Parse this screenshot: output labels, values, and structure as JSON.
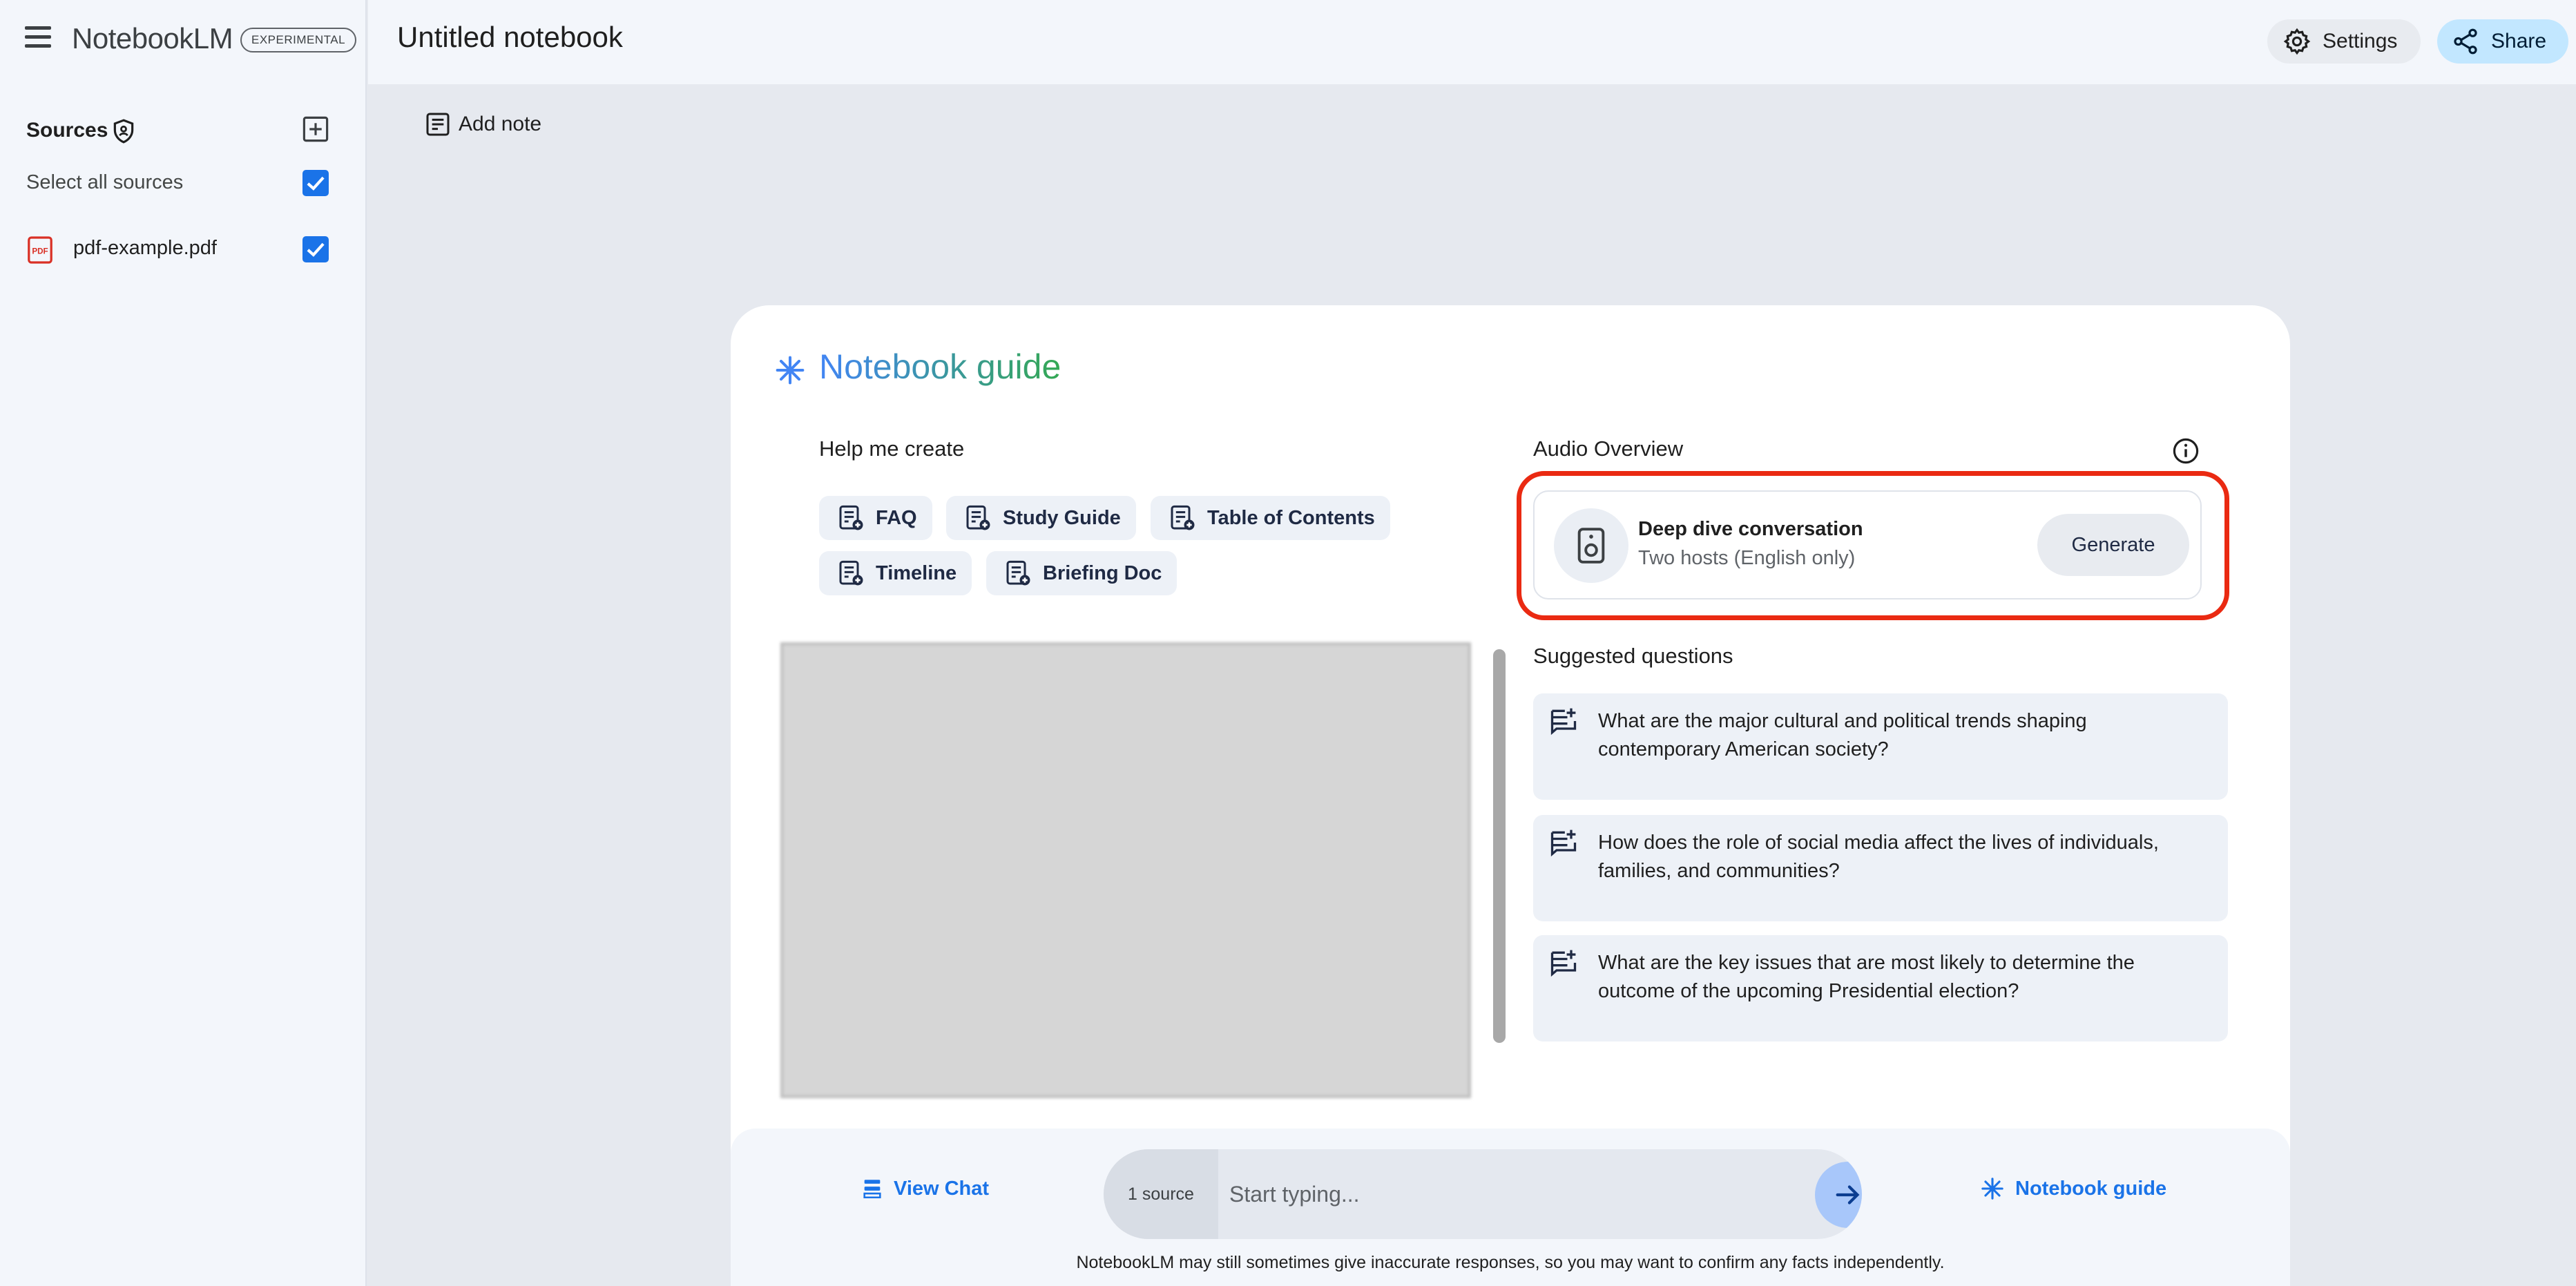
{
  "sidebar": {
    "logo": "NotebookLM",
    "badge": "EXPERIMENTAL",
    "sources_title": "Sources",
    "select_all_label": "Select all sources",
    "select_all_checked": true,
    "sources": [
      {
        "name": "pdf-example.pdf",
        "checked": true,
        "icon": "pdf-icon"
      }
    ]
  },
  "header": {
    "notebook_title": "Untitled notebook",
    "settings_label": "Settings",
    "share_label": "Share"
  },
  "toolbar": {
    "add_note_label": "Add note"
  },
  "guide": {
    "title": "Notebook guide",
    "help_label": "Help me create",
    "chips": [
      "FAQ",
      "Study Guide",
      "Table of Contents",
      "Timeline",
      "Briefing Doc"
    ],
    "audio": {
      "label": "Audio Overview",
      "title": "Deep dive conversation",
      "subtitle": "Two hosts (English only)",
      "generate_label": "Generate"
    },
    "suggested_label": "Suggested questions",
    "questions": [
      "What are the major cultural and political trends shaping contemporary American society?",
      "How does the role of social media affect the lives of individuals, families, and communities?",
      "What are the key issues that are most likely to determine the outcome of the upcoming Presidential election?"
    ]
  },
  "chat": {
    "view_chat_label": "View Chat",
    "source_count": "1 source",
    "placeholder": "Start typing...",
    "guide_link_label": "Notebook guide",
    "disclaimer": "NotebookLM may still sometimes give inaccurate responses, so you may want to confirm any facts independently."
  },
  "colors": {
    "accent": "#1a73e8",
    "highlight": "#ea2a12",
    "share_bg": "#c2e7ff"
  }
}
